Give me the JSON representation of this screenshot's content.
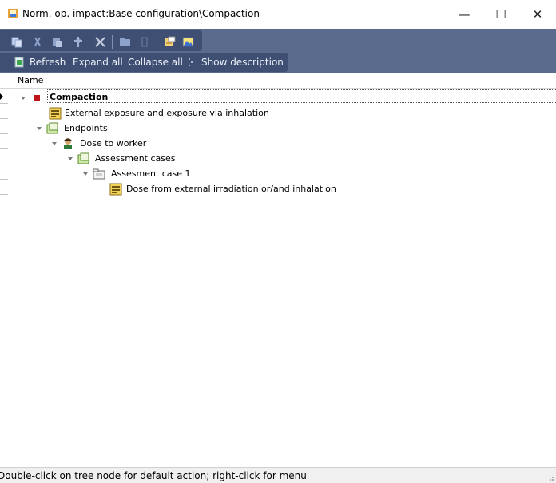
{
  "window": {
    "title": "Norm. op. impact:Base configuration\\Compaction",
    "minimize_glyph": "—",
    "maximize_glyph": "☐",
    "close_glyph": "✕"
  },
  "toolbar_icons": [
    "copy-icon",
    "cut-icon",
    "paste-icon",
    "tool-icon",
    "delete-icon",
    "folder-icon",
    "clipboard-icon",
    "properties-icon",
    "image-icon"
  ],
  "toolbar2": {
    "refresh": "Refresh",
    "expand_all": "Expand all",
    "collapse_all": "Collapse all",
    "show_description": "Show description"
  },
  "tree": {
    "column_header": "Name",
    "nodes": [
      {
        "label": "Compaction",
        "icon": "red-square-icon",
        "bold": true
      },
      {
        "label": "External exposure and exposure via inhalation",
        "icon": "scenario-icon"
      },
      {
        "label": "Endpoints",
        "icon": "folder-green-icon"
      },
      {
        "label": "Dose to worker",
        "icon": "worker-icon"
      },
      {
        "label": "Assessment cases",
        "icon": "folder-green-icon"
      },
      {
        "label": "Assesment case 1",
        "icon": "folder-grey-icon"
      },
      {
        "label": "Dose from external irradiation or/and inhalation",
        "icon": "scenario-icon"
      }
    ]
  },
  "status": {
    "text": "Double-click on tree node for default action; right-click for menu"
  }
}
